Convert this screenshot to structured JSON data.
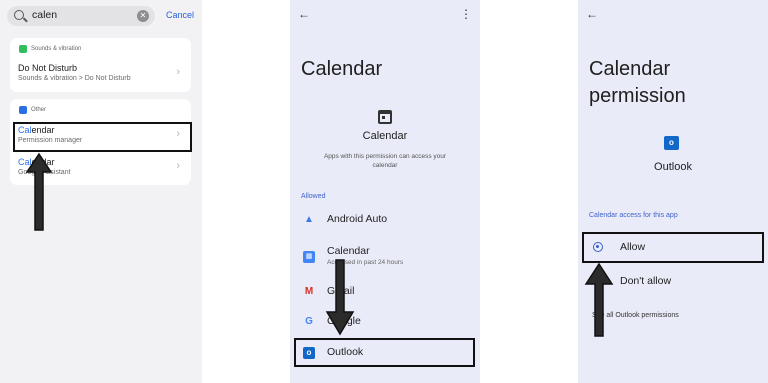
{
  "search_panel": {
    "query": "calen",
    "clear_icon": "clear-icon",
    "cancel_label": "Cancel",
    "section1": {
      "label": "Sounds & vibration",
      "color": "#2fbf5f",
      "item": {
        "title": "Do Not Disturb",
        "subtitle": "Sounds & vibration > Do Not Disturb"
      }
    },
    "section2": {
      "label": "Other",
      "color": "#2a6ee8",
      "items": [
        {
          "title_match": "Cal",
          "title_rest": "endar",
          "subtitle": "Permission manager"
        },
        {
          "title_match": "Cal",
          "title_rest": "endar",
          "subtitle": "Google Assistant"
        }
      ]
    }
  },
  "permission_list": {
    "title": "Calendar",
    "permission_name": "Calendar",
    "description": "Apps with this permission can access your calendar",
    "allowed_label": "Allowed",
    "apps": [
      {
        "name": "Android Auto",
        "subtitle": "",
        "icon": "android-auto-icon",
        "color": "#3b7be8"
      },
      {
        "name": "Calendar",
        "subtitle": "Accessed in past 24 hours",
        "icon": "google-calendar-icon",
        "color": "#4285f4"
      },
      {
        "name": "Gmail",
        "subtitle": "",
        "icon": "gmail-icon",
        "color": "#d93025"
      },
      {
        "name": "Google",
        "subtitle": "",
        "icon": "google-icon",
        "color": "#4285f4"
      },
      {
        "name": "Outlook",
        "subtitle": "",
        "icon": "outlook-icon",
        "color": "#1268c9"
      }
    ]
  },
  "app_permission": {
    "title": "Calendar permission",
    "app_name": "Outlook",
    "section_label": "Calendar access for this app",
    "options": [
      {
        "label": "Allow",
        "selected": true
      },
      {
        "label": "Don't allow",
        "selected": false
      }
    ],
    "see_all": "See all Outlook permissions"
  }
}
